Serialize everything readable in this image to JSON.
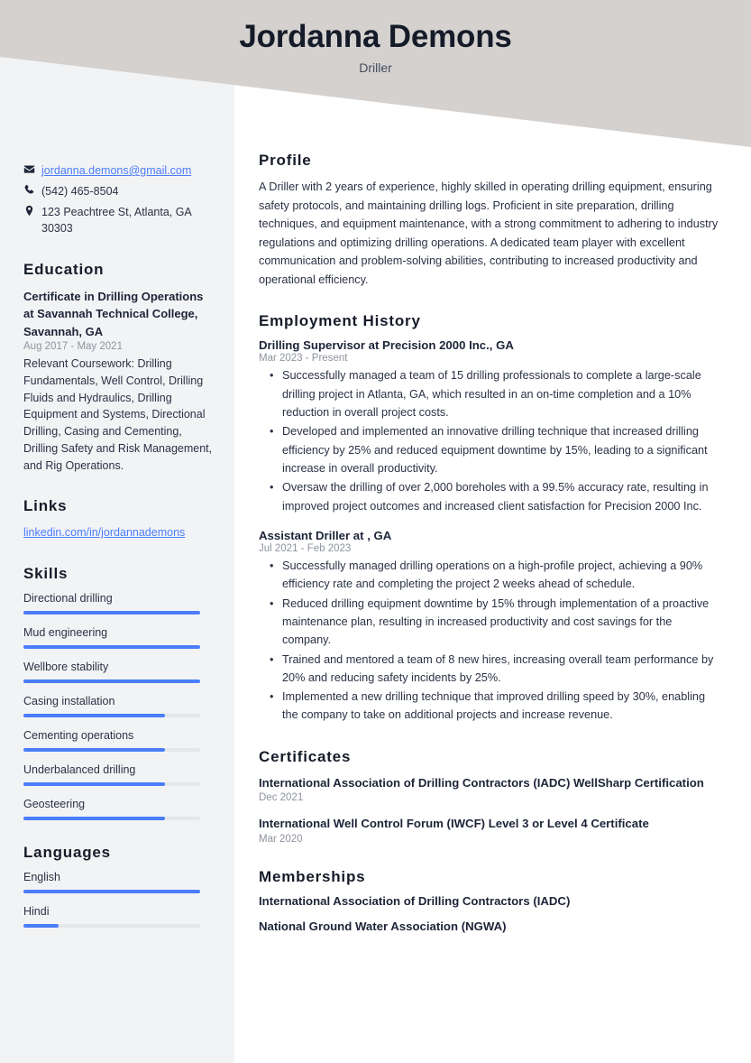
{
  "header": {
    "name": "Jordanna Demons",
    "job_title": "Driller",
    "banner_color": "#d4d1cf"
  },
  "theme": {
    "accent_color": "#4a7dfa",
    "sidebar_color": "#f2f3f5",
    "text_color": "#2b3245",
    "muted_color": "#8e939e"
  },
  "sidebar": {
    "contact": [
      {
        "icon": "envelope-icon",
        "text": "jordanna.demons@gmail.com",
        "is_link": true
      },
      {
        "icon": "phone-icon",
        "text": "(542) 465-8504",
        "is_link": false
      },
      {
        "icon": "location-pin-icon",
        "text": "123 Peachtree St, Atlanta, GA 30303",
        "is_link": false
      }
    ],
    "education": {
      "heading": "Education",
      "items": [
        {
          "title": "Certificate in Drilling Operations at Savannah Technical College, Savannah, GA",
          "date": "Aug 2017 - May 2021",
          "description": "Relevant Coursework: Drilling Fundamentals, Well Control, Drilling Fluids and Hydraulics, Drilling Equipment and Systems, Directional Drilling, Casing and Cementing, Drilling Safety and Risk Management, and Rig Operations."
        }
      ]
    },
    "links": {
      "heading": "Links",
      "items": [
        {
          "label": "linkedin.com/in/jordannademons"
        }
      ]
    },
    "skills": {
      "heading": "Skills",
      "items": [
        {
          "label": "Directional drilling",
          "level": 100
        },
        {
          "label": "Mud engineering",
          "level": 100
        },
        {
          "label": "Wellbore stability",
          "level": 100
        },
        {
          "label": "Casing installation",
          "level": 80
        },
        {
          "label": "Cementing operations",
          "level": 80
        },
        {
          "label": "Underbalanced drilling",
          "level": 80
        },
        {
          "label": "Geosteering",
          "level": 80
        }
      ]
    },
    "languages": {
      "heading": "Languages",
      "items": [
        {
          "label": "English",
          "level": 100
        },
        {
          "label": "Hindi",
          "level": 20
        }
      ]
    }
  },
  "main": {
    "profile": {
      "heading": "Profile",
      "text": "A Driller with 2 years of experience, highly skilled in operating drilling equipment, ensuring safety protocols, and maintaining drilling logs. Proficient in site preparation, drilling techniques, and equipment maintenance, with a strong commitment to adhering to industry regulations and optimizing drilling operations. A dedicated team player with excellent communication and problem-solving abilities, contributing to increased productivity and operational efficiency."
    },
    "employment": {
      "heading": "Employment History",
      "jobs": [
        {
          "title": "Drilling Supervisor at Precision 2000 Inc., GA",
          "date": "Mar 2023 - Present",
          "bullets": [
            "Successfully managed a team of 15 drilling professionals to complete a large-scale drilling project in Atlanta, GA, which resulted in an on-time completion and a 10% reduction in overall project costs.",
            "Developed and implemented an innovative drilling technique that increased drilling efficiency by 25% and reduced equipment downtime by 15%, leading to a significant increase in overall productivity.",
            "Oversaw the drilling of over 2,000 boreholes with a 99.5% accuracy rate, resulting in improved project outcomes and increased client satisfaction for Precision 2000 Inc."
          ]
        },
        {
          "title": "Assistant Driller at , GA",
          "date": "Jul 2021 - Feb 2023",
          "bullets": [
            "Successfully managed drilling operations on a high-profile project, achieving a 90% efficiency rate and completing the project 2 weeks ahead of schedule.",
            "Reduced drilling equipment downtime by 15% through implementation of a proactive maintenance plan, resulting in increased productivity and cost savings for the company.",
            "Trained and mentored a team of 8 new hires, increasing overall team performance by 20% and reducing safety incidents by 25%.",
            "Implemented a new drilling technique that improved drilling speed by 30%, enabling the company to take on additional projects and increase revenue."
          ]
        }
      ]
    },
    "certificates": {
      "heading": "Certificates",
      "items": [
        {
          "title": "International Association of Drilling Contractors (IADC) WellSharp Certification",
          "date": "Dec 2021"
        },
        {
          "title": "International Well Control Forum (IWCF) Level 3 or Level 4 Certificate",
          "date": "Mar 2020"
        }
      ]
    },
    "memberships": {
      "heading": "Memberships",
      "items": [
        {
          "label": "International Association of Drilling Contractors (IADC)"
        },
        {
          "label": "National Ground Water Association (NGWA)"
        }
      ]
    }
  }
}
